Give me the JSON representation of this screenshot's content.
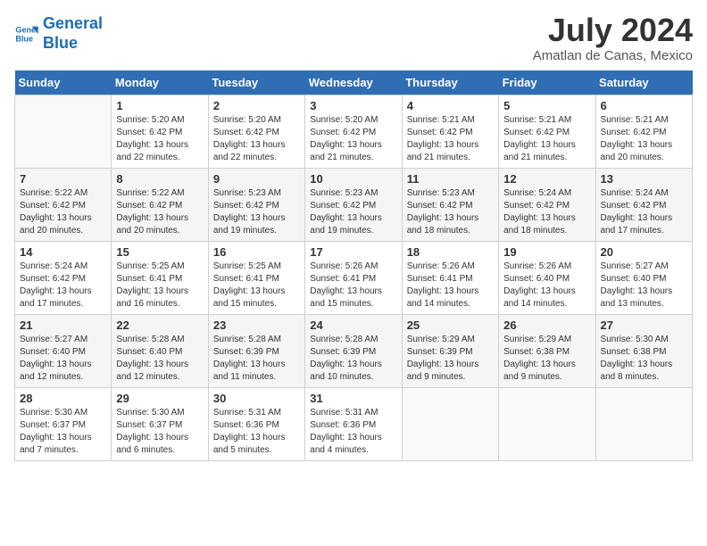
{
  "header": {
    "logo_line1": "General",
    "logo_line2": "Blue",
    "month_title": "July 2024",
    "location": "Amatlan de Canas, Mexico"
  },
  "weekdays": [
    "Sunday",
    "Monday",
    "Tuesday",
    "Wednesday",
    "Thursday",
    "Friday",
    "Saturday"
  ],
  "weeks": [
    [
      {
        "day": "",
        "sunrise": "",
        "sunset": "",
        "daylight": ""
      },
      {
        "day": "1",
        "sunrise": "Sunrise: 5:20 AM",
        "sunset": "Sunset: 6:42 PM",
        "daylight": "Daylight: 13 hours and 22 minutes."
      },
      {
        "day": "2",
        "sunrise": "Sunrise: 5:20 AM",
        "sunset": "Sunset: 6:42 PM",
        "daylight": "Daylight: 13 hours and 22 minutes."
      },
      {
        "day": "3",
        "sunrise": "Sunrise: 5:20 AM",
        "sunset": "Sunset: 6:42 PM",
        "daylight": "Daylight: 13 hours and 21 minutes."
      },
      {
        "day": "4",
        "sunrise": "Sunrise: 5:21 AM",
        "sunset": "Sunset: 6:42 PM",
        "daylight": "Daylight: 13 hours and 21 minutes."
      },
      {
        "day": "5",
        "sunrise": "Sunrise: 5:21 AM",
        "sunset": "Sunset: 6:42 PM",
        "daylight": "Daylight: 13 hours and 21 minutes."
      },
      {
        "day": "6",
        "sunrise": "Sunrise: 5:21 AM",
        "sunset": "Sunset: 6:42 PM",
        "daylight": "Daylight: 13 hours and 20 minutes."
      }
    ],
    [
      {
        "day": "7",
        "sunrise": "Sunrise: 5:22 AM",
        "sunset": "Sunset: 6:42 PM",
        "daylight": "Daylight: 13 hours and 20 minutes."
      },
      {
        "day": "8",
        "sunrise": "Sunrise: 5:22 AM",
        "sunset": "Sunset: 6:42 PM",
        "daylight": "Daylight: 13 hours and 20 minutes."
      },
      {
        "day": "9",
        "sunrise": "Sunrise: 5:23 AM",
        "sunset": "Sunset: 6:42 PM",
        "daylight": "Daylight: 13 hours and 19 minutes."
      },
      {
        "day": "10",
        "sunrise": "Sunrise: 5:23 AM",
        "sunset": "Sunset: 6:42 PM",
        "daylight": "Daylight: 13 hours and 19 minutes."
      },
      {
        "day": "11",
        "sunrise": "Sunrise: 5:23 AM",
        "sunset": "Sunset: 6:42 PM",
        "daylight": "Daylight: 13 hours and 18 minutes."
      },
      {
        "day": "12",
        "sunrise": "Sunrise: 5:24 AM",
        "sunset": "Sunset: 6:42 PM",
        "daylight": "Daylight: 13 hours and 18 minutes."
      },
      {
        "day": "13",
        "sunrise": "Sunrise: 5:24 AM",
        "sunset": "Sunset: 6:42 PM",
        "daylight": "Daylight: 13 hours and 17 minutes."
      }
    ],
    [
      {
        "day": "14",
        "sunrise": "Sunrise: 5:24 AM",
        "sunset": "Sunset: 6:42 PM",
        "daylight": "Daylight: 13 hours and 17 minutes."
      },
      {
        "day": "15",
        "sunrise": "Sunrise: 5:25 AM",
        "sunset": "Sunset: 6:41 PM",
        "daylight": "Daylight: 13 hours and 16 minutes."
      },
      {
        "day": "16",
        "sunrise": "Sunrise: 5:25 AM",
        "sunset": "Sunset: 6:41 PM",
        "daylight": "Daylight: 13 hours and 15 minutes."
      },
      {
        "day": "17",
        "sunrise": "Sunrise: 5:26 AM",
        "sunset": "Sunset: 6:41 PM",
        "daylight": "Daylight: 13 hours and 15 minutes."
      },
      {
        "day": "18",
        "sunrise": "Sunrise: 5:26 AM",
        "sunset": "Sunset: 6:41 PM",
        "daylight": "Daylight: 13 hours and 14 minutes."
      },
      {
        "day": "19",
        "sunrise": "Sunrise: 5:26 AM",
        "sunset": "Sunset: 6:40 PM",
        "daylight": "Daylight: 13 hours and 14 minutes."
      },
      {
        "day": "20",
        "sunrise": "Sunrise: 5:27 AM",
        "sunset": "Sunset: 6:40 PM",
        "daylight": "Daylight: 13 hours and 13 minutes."
      }
    ],
    [
      {
        "day": "21",
        "sunrise": "Sunrise: 5:27 AM",
        "sunset": "Sunset: 6:40 PM",
        "daylight": "Daylight: 13 hours and 12 minutes."
      },
      {
        "day": "22",
        "sunrise": "Sunrise: 5:28 AM",
        "sunset": "Sunset: 6:40 PM",
        "daylight": "Daylight: 13 hours and 12 minutes."
      },
      {
        "day": "23",
        "sunrise": "Sunrise: 5:28 AM",
        "sunset": "Sunset: 6:39 PM",
        "daylight": "Daylight: 13 hours and 11 minutes."
      },
      {
        "day": "24",
        "sunrise": "Sunrise: 5:28 AM",
        "sunset": "Sunset: 6:39 PM",
        "daylight": "Daylight: 13 hours and 10 minutes."
      },
      {
        "day": "25",
        "sunrise": "Sunrise: 5:29 AM",
        "sunset": "Sunset: 6:39 PM",
        "daylight": "Daylight: 13 hours and 9 minutes."
      },
      {
        "day": "26",
        "sunrise": "Sunrise: 5:29 AM",
        "sunset": "Sunset: 6:38 PM",
        "daylight": "Daylight: 13 hours and 9 minutes."
      },
      {
        "day": "27",
        "sunrise": "Sunrise: 5:30 AM",
        "sunset": "Sunset: 6:38 PM",
        "daylight": "Daylight: 13 hours and 8 minutes."
      }
    ],
    [
      {
        "day": "28",
        "sunrise": "Sunrise: 5:30 AM",
        "sunset": "Sunset: 6:37 PM",
        "daylight": "Daylight: 13 hours and 7 minutes."
      },
      {
        "day": "29",
        "sunrise": "Sunrise: 5:30 AM",
        "sunset": "Sunset: 6:37 PM",
        "daylight": "Daylight: 13 hours and 6 minutes."
      },
      {
        "day": "30",
        "sunrise": "Sunrise: 5:31 AM",
        "sunset": "Sunset: 6:36 PM",
        "daylight": "Daylight: 13 hours and 5 minutes."
      },
      {
        "day": "31",
        "sunrise": "Sunrise: 5:31 AM",
        "sunset": "Sunset: 6:36 PM",
        "daylight": "Daylight: 13 hours and 4 minutes."
      },
      {
        "day": "",
        "sunrise": "",
        "sunset": "",
        "daylight": ""
      },
      {
        "day": "",
        "sunrise": "",
        "sunset": "",
        "daylight": ""
      },
      {
        "day": "",
        "sunrise": "",
        "sunset": "",
        "daylight": ""
      }
    ]
  ]
}
